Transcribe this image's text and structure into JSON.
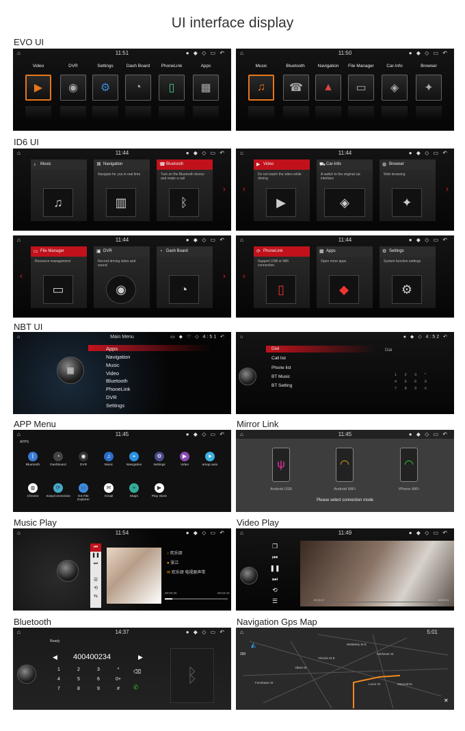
{
  "title": "UI interface display",
  "sections": {
    "evo": "EVO UI",
    "id6": "ID6 UI",
    "nbt": "NBT UI",
    "app": "APP Menu",
    "mirror": "Mirror Link",
    "music": "Music Play",
    "video": "Video Play",
    "bt": "Bluetooth",
    "nav": "Navigation Gps Map"
  },
  "times": {
    "evo1": "11:51",
    "evo2": "11:50",
    "id1": "11:44",
    "id2": "11:44",
    "id3": "11:44",
    "id4": "11:44",
    "nbt1": "4:51",
    "nbt2": "4:52",
    "app": "11:45",
    "mirror": "11:45",
    "music": "11:54",
    "video": "11:49",
    "bt": "14:37",
    "nav": "5:01"
  },
  "evo1": [
    "Video",
    "DVR",
    "Settings",
    "Dash Board",
    "PhoneLink",
    "Apps"
  ],
  "evo2": [
    "Music",
    "Bluetooth",
    "Navigation",
    "File Manager",
    "Car-Info",
    "Browser"
  ],
  "id6_1": [
    {
      "t": "Music",
      "d": ""
    },
    {
      "t": "Navigation",
      "d": "Navigate for you in real time"
    },
    {
      "t": "Bluetooth",
      "d": "Turn on the Bluetooth device and make a call"
    }
  ],
  "id6_2": [
    {
      "t": "Video",
      "d": "Do not watch the video while driving"
    },
    {
      "t": "Car-Info",
      "d": "A switch to the original car interface"
    },
    {
      "t": "Browser",
      "d": "Web browsing"
    }
  ],
  "id6_3": [
    {
      "t": "File Manager",
      "d": "Resource management"
    },
    {
      "t": "DVR",
      "d": "Record driving video and sound"
    },
    {
      "t": "Dash Board",
      "d": ""
    }
  ],
  "id6_4": [
    {
      "t": "PhoneLink",
      "d": "Support USB or Wifi connection"
    },
    {
      "t": "Apps",
      "d": "Open more apps"
    },
    {
      "t": "Settings",
      "d": "System function settings"
    }
  ],
  "nbt1": {
    "header": "Main Menu",
    "items": [
      "Apps",
      "Navigation",
      "Music",
      "Video",
      "Bluetooth",
      "PhoneLink",
      "DVR",
      "Settings"
    ]
  },
  "nbt2": {
    "items": [
      "Dial",
      "Call list",
      "Phone list",
      "BT Music",
      "BT Setting"
    ],
    "right": "Dial"
  },
  "apps": {
    "tab": "APPS",
    "row1": [
      "Bluetooth",
      "Dashboard",
      "DVR",
      "Music",
      "Navigation",
      "Settings",
      "Video",
      "amap auto"
    ],
    "row2": [
      "Chrome",
      "EasyConnection",
      "ES File Explorer",
      "Gmail",
      "Maps",
      "Play Store"
    ]
  },
  "mirror": {
    "devices": [
      "Android USB",
      "Android WiFi",
      "iPhone WiFi"
    ],
    "msg": "Please select connection mode"
  },
  "music": {
    "song": "欢乐颂",
    "artist": "张江",
    "album": "欢乐颂 电视原声带",
    "t0": "00:00:35",
    "t1": "00:04:42"
  },
  "video": {
    "t0": "00:00:47",
    "t1": "00:02:31"
  },
  "bt": {
    "status": "Ready",
    "number": "400400234",
    "keys": [
      "1",
      "2",
      "3",
      "*",
      "4",
      "5",
      "6",
      "0+",
      "7",
      "8",
      "9",
      "#"
    ]
  },
  "nav": {
    "streets": [
      "Wellesley St E",
      "Albert St",
      "Fanshawe St",
      "Lorne St",
      "Mayoral Dr",
      "Victoria St E",
      "Kitchener St"
    ],
    "scale": "250"
  }
}
